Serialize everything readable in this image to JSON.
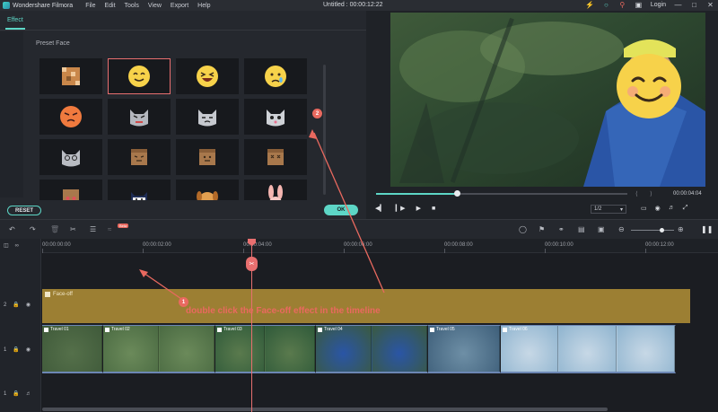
{
  "app": {
    "name": "Wondershare Filmora",
    "title": "Untitled : 00:00:12:22",
    "menu": [
      "File",
      "Edit",
      "Tools",
      "View",
      "Export",
      "Help"
    ],
    "login": "Login"
  },
  "effects_panel": {
    "tab": "Effect",
    "section": "Preset Face",
    "items": [
      {
        "icon": "pixel-mosaic-icon",
        "selected": false
      },
      {
        "icon": "smiley-face-icon",
        "selected": true
      },
      {
        "icon": "laughing-face-icon",
        "selected": false
      },
      {
        "icon": "sad-face-icon",
        "selected": false
      },
      {
        "icon": "angry-face-icon",
        "selected": false
      },
      {
        "icon": "angry-cat-icon",
        "selected": false
      },
      {
        "icon": "grumpy-cat-icon",
        "selected": false
      },
      {
        "icon": "surprised-cat-icon",
        "selected": false
      },
      {
        "icon": "dizzy-cat-icon",
        "selected": false
      },
      {
        "icon": "box-face-icon",
        "selected": false
      },
      {
        "icon": "box-face-neutral-icon",
        "selected": false
      },
      {
        "icon": "box-face-dizzy-icon",
        "selected": false
      },
      {
        "icon": "box-face-heart-icon",
        "selected": false
      },
      {
        "icon": "ninja-cat-icon",
        "selected": false
      },
      {
        "icon": "dog-face-icon",
        "selected": false
      },
      {
        "icon": "bunny-face-icon",
        "selected": false
      }
    ],
    "reset_label": "RESET",
    "ok_label": "OK"
  },
  "preview": {
    "timecode": "00:00:04:04",
    "zoom": "1/2",
    "progress": 0.32
  },
  "toolbar": {
    "beta_label": "Beta"
  },
  "timeline": {
    "ruler": [
      "00:00:00:00",
      "00:00:02:00",
      "00:00:04:00",
      "00:00:06:00",
      "00:00:08:00",
      "00:00:10:00",
      "00:00:12:00"
    ],
    "effect_track_label": "Face-off",
    "clips": [
      "Travel 01",
      "Travel 02",
      "Travel 03",
      "Travel 04",
      "Travel 05",
      "Travel 06"
    ],
    "track_effect": "2",
    "track_video": "1",
    "track_audio": "1"
  },
  "annotations": {
    "step1": "1",
    "step2": "2",
    "instruction": "double click the Face-off effect in the timeline"
  },
  "colors": {
    "accent": "#5dd6c6",
    "annotation": "#e9695f",
    "effect_track": "#9c7f33",
    "clip_border": "#6c86b4"
  }
}
